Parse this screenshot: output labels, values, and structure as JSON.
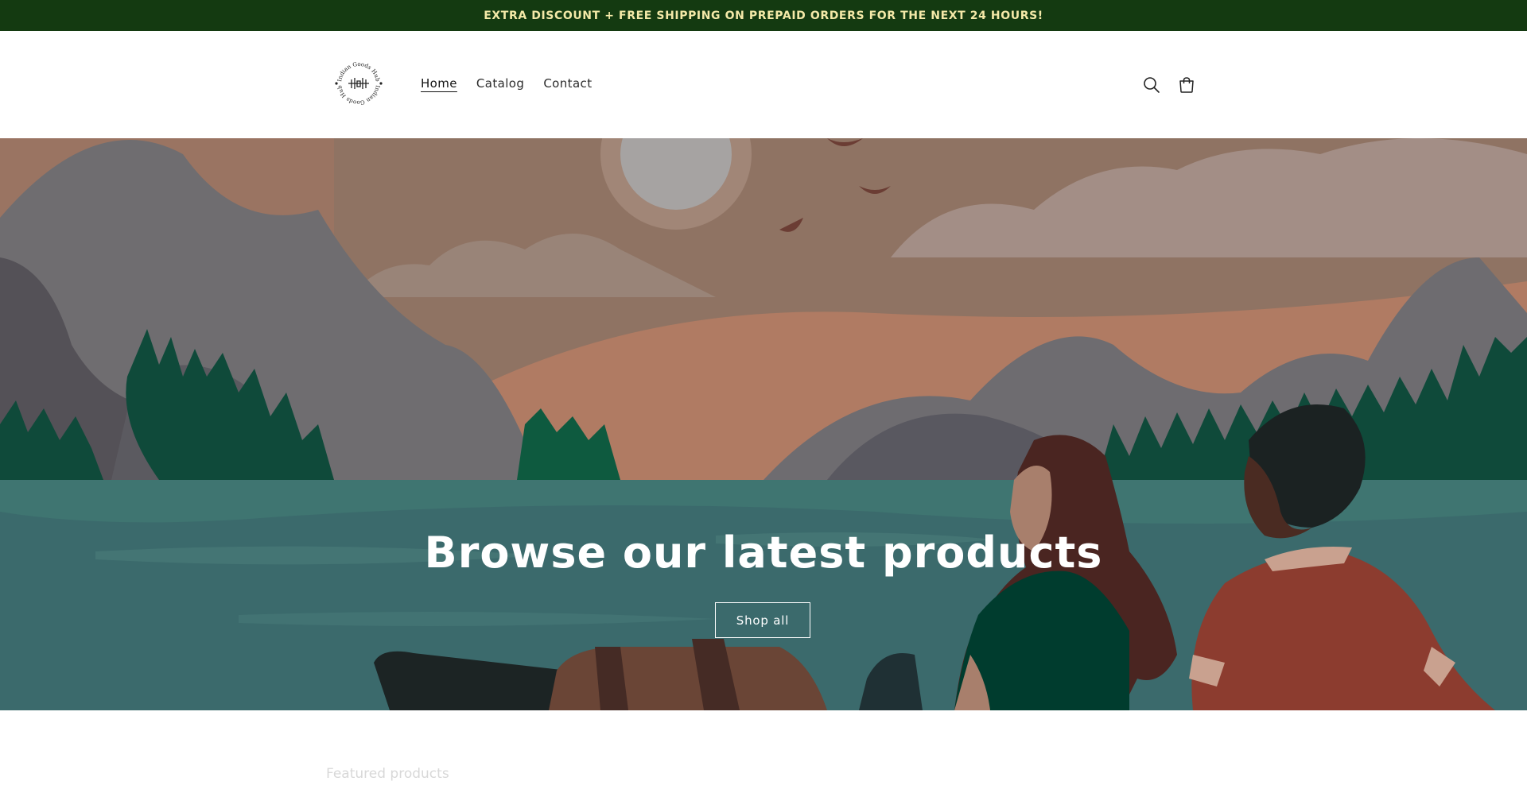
{
  "announcement": {
    "text": "EXTRA DISCOUNT + FREE SHIPPING ON PREPAID ORDERS FOR THE NEXT 24 HOURS!",
    "background": "#143a11",
    "text_color": "#f4e9a8"
  },
  "header": {
    "logo": {
      "brand_text": "Indian Goods Hub",
      "icon": "logo-seal-icon"
    },
    "nav": [
      {
        "label": "Home",
        "active": true
      },
      {
        "label": "Catalog",
        "active": false
      },
      {
        "label": "Contact",
        "active": false
      }
    ],
    "icons": {
      "search": "search-icon",
      "cart": "cart-icon"
    }
  },
  "hero": {
    "title": "Browse our latest products",
    "button_label": "Shop all"
  },
  "below": {
    "heading": "Featured products"
  }
}
